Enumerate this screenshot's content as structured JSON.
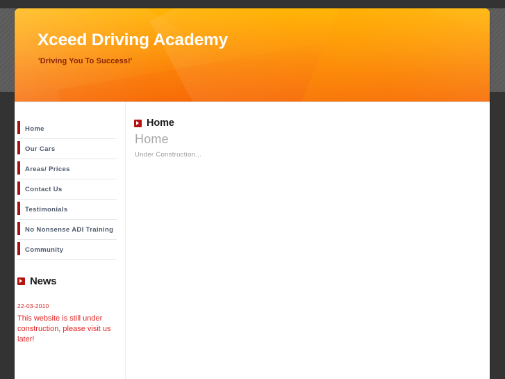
{
  "banner": {
    "title": "Xceed Driving Academy",
    "tagline": "'Driving You To Success!'"
  },
  "sidebar": {
    "nav_items": [
      {
        "label": "Home"
      },
      {
        "label": "Our Cars"
      },
      {
        "label": "Areas/ Prices"
      },
      {
        "label": "Contact Us"
      },
      {
        "label": "Testimonials"
      },
      {
        "label": "No Nonsense ADI Training"
      },
      {
        "label": "Community"
      }
    ],
    "news": {
      "heading": "News",
      "date": "22-03-2010",
      "body": "This website is still under construction, please visit us later!"
    }
  },
  "main": {
    "page_heading": "Home",
    "content_title": "Home",
    "content_text": "Under Construction..."
  },
  "colors": {
    "accent_red": "#a81111",
    "icon_red": "#b51212",
    "news_text_red": "#e02626",
    "banner_orange_top": "#ffb300",
    "banner_orange_bottom": "#f76a06",
    "tagline_maroon": "#8a2408",
    "nav_label": "#4d5a6b",
    "page_background": "#333333"
  }
}
